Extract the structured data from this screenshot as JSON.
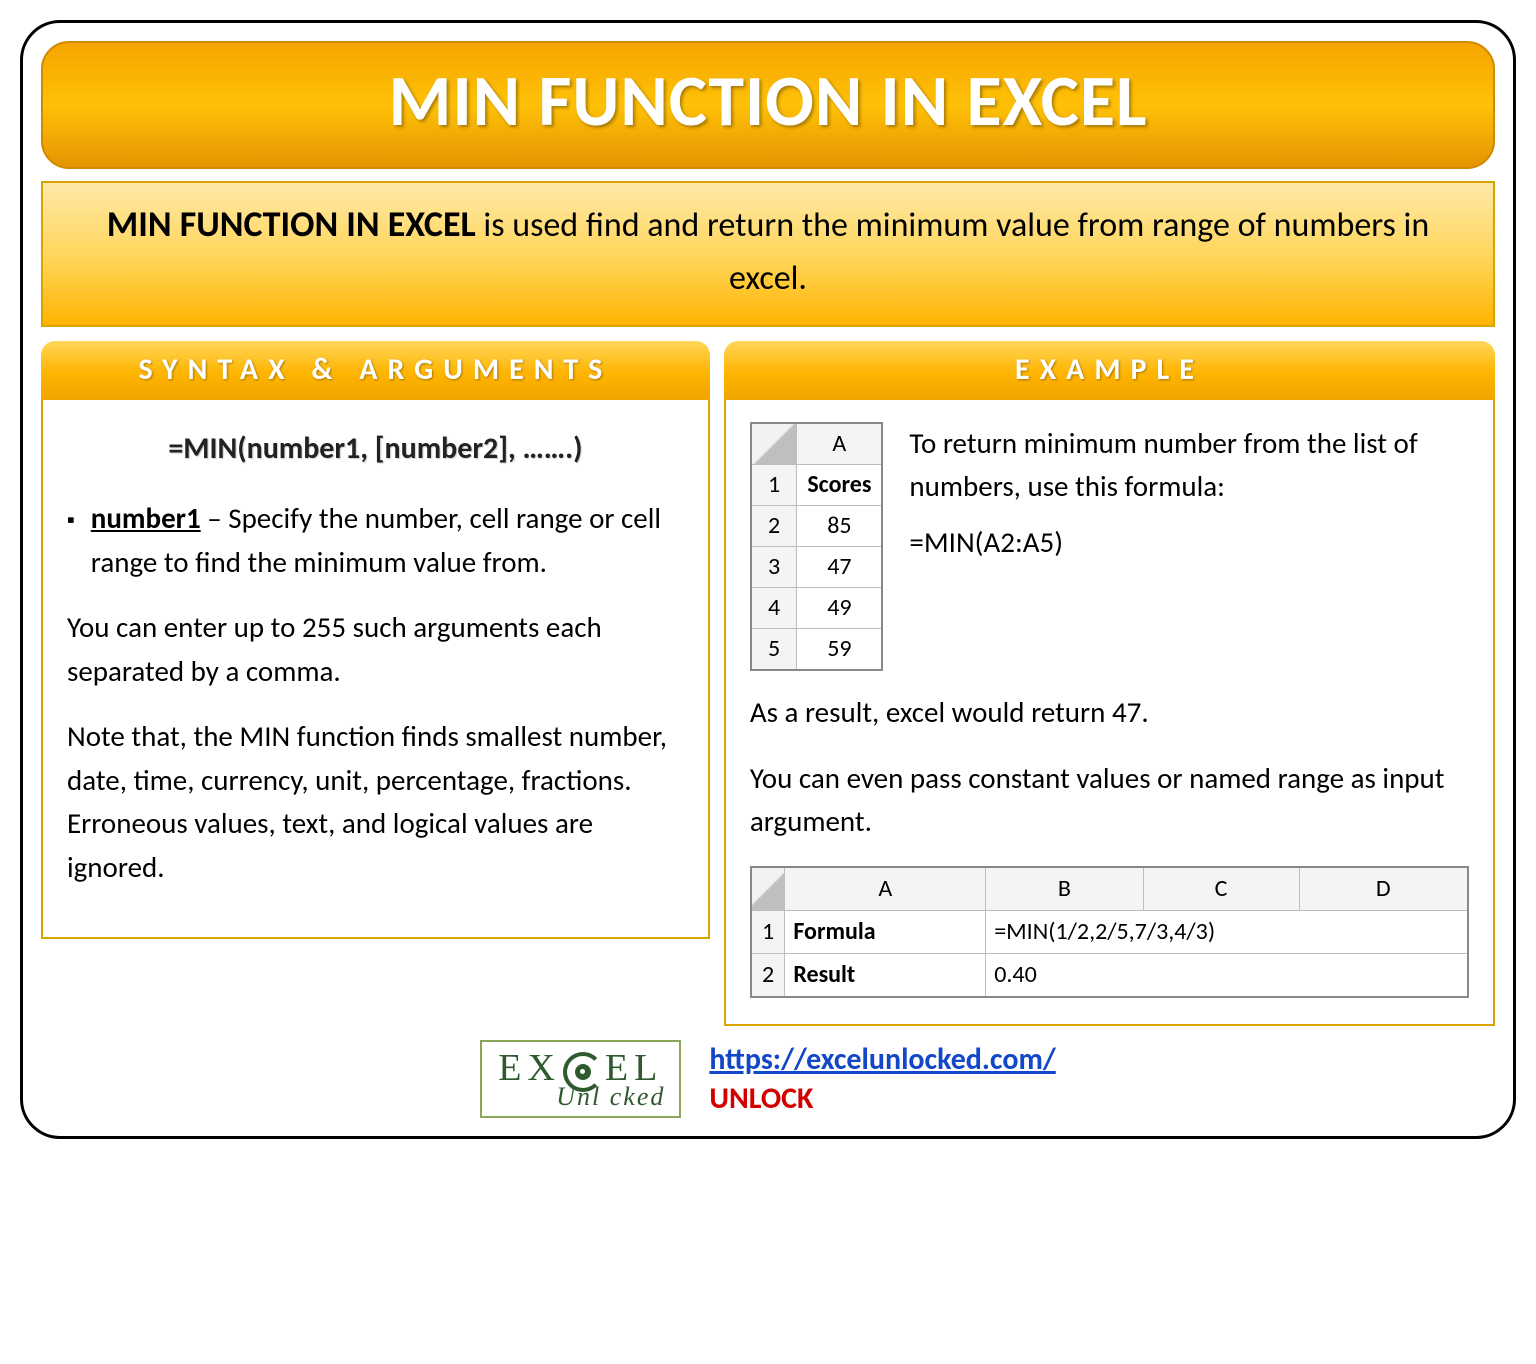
{
  "title": "MIN FUNCTION IN EXCEL",
  "intro": {
    "lead": "MIN FUNCTION IN EXCEL",
    "rest": " is used find and return the minimum value from range of numbers in excel."
  },
  "syntax": {
    "header": "SYNTAX & ARGUMENTS",
    "formula": "=MIN(number1, [number2], …….)",
    "arg_name": "number1",
    "arg_desc": " – Specify the number, cell range or cell range to find the minimum value from.",
    "para1": "You can enter up to 255 such arguments each separated by a comma.",
    "para2": "Note that, the MIN function finds smallest number, date, time, currency, unit, percentage, fractions. Erroneous values, text, and logical values are ignored."
  },
  "example": {
    "header": "EXAMPLE",
    "table1": {
      "col": "A",
      "header_cell": "Scores",
      "rows": [
        "1",
        "2",
        "3",
        "4",
        "5"
      ],
      "values": [
        "85",
        "47",
        "49",
        "59"
      ]
    },
    "desc": "To return minimum number from the list of numbers, use this formula:",
    "formula": "=MIN(A2:A5)",
    "result_line": "As a result, excel would return 47.",
    "extra": "You can even pass constant values or named range as input argument.",
    "table2": {
      "cols": [
        "A",
        "B",
        "C",
        "D"
      ],
      "rows": [
        "1",
        "2"
      ],
      "labelA": "Formula",
      "valA": "=MIN(1/2,2/5,7/3,4/3)",
      "labelB": "Result",
      "valB": "0.40"
    }
  },
  "footer": {
    "logo_top_left": "EX",
    "logo_top_right": "EL",
    "logo_bottom": "Unl   cked",
    "url": "https://excelunlocked.com/",
    "unlock": "UNLOCK"
  }
}
